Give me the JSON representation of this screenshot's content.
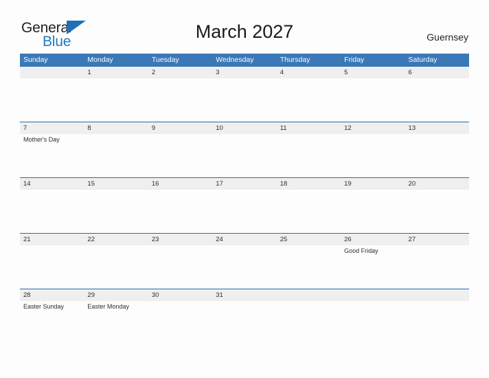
{
  "brand": {
    "name_part1": "General",
    "name_part2": "Blue",
    "flag_icon": "flag-triangle-icon",
    "color_primary": "#1e7ac1",
    "color_dark": "#231f20"
  },
  "header": {
    "title": "March 2027",
    "locale": "Guernsey"
  },
  "calendar": {
    "header_bg": "#3a78b7",
    "date_band_bg": "#efefef",
    "rule_color": "#1f6cb0",
    "day_names": [
      "Sunday",
      "Monday",
      "Tuesday",
      "Wednesday",
      "Thursday",
      "Friday",
      "Saturday"
    ],
    "weeks": [
      {
        "days": [
          {
            "date": "",
            "events": []
          },
          {
            "date": "1",
            "events": []
          },
          {
            "date": "2",
            "events": []
          },
          {
            "date": "3",
            "events": []
          },
          {
            "date": "4",
            "events": []
          },
          {
            "date": "5",
            "events": []
          },
          {
            "date": "6",
            "events": []
          }
        ]
      },
      {
        "days": [
          {
            "date": "7",
            "events": [
              "Mother's Day"
            ]
          },
          {
            "date": "8",
            "events": []
          },
          {
            "date": "9",
            "events": []
          },
          {
            "date": "10",
            "events": []
          },
          {
            "date": "11",
            "events": []
          },
          {
            "date": "12",
            "events": []
          },
          {
            "date": "13",
            "events": []
          }
        ]
      },
      {
        "days": [
          {
            "date": "14",
            "events": []
          },
          {
            "date": "15",
            "events": []
          },
          {
            "date": "16",
            "events": []
          },
          {
            "date": "17",
            "events": []
          },
          {
            "date": "18",
            "events": []
          },
          {
            "date": "19",
            "events": []
          },
          {
            "date": "20",
            "events": []
          }
        ]
      },
      {
        "days": [
          {
            "date": "21",
            "events": []
          },
          {
            "date": "22",
            "events": []
          },
          {
            "date": "23",
            "events": []
          },
          {
            "date": "24",
            "events": []
          },
          {
            "date": "25",
            "events": []
          },
          {
            "date": "26",
            "events": [
              "Good Friday"
            ]
          },
          {
            "date": "27",
            "events": []
          }
        ]
      },
      {
        "days": [
          {
            "date": "28",
            "events": [
              "Easter Sunday"
            ]
          },
          {
            "date": "29",
            "events": [
              "Easter Monday"
            ]
          },
          {
            "date": "30",
            "events": []
          },
          {
            "date": "31",
            "events": []
          },
          {
            "date": "",
            "events": []
          },
          {
            "date": "",
            "events": []
          },
          {
            "date": "",
            "events": []
          }
        ]
      }
    ]
  }
}
